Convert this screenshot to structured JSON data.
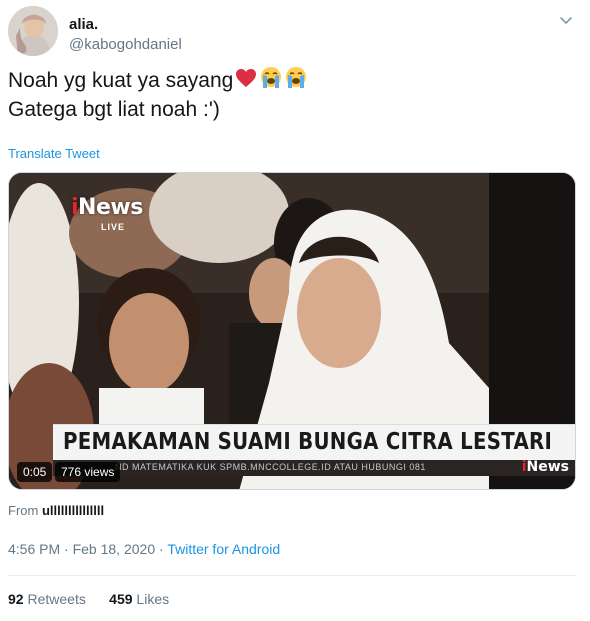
{
  "user": {
    "display_name": "alia.",
    "handle": "@kabogohdaniel"
  },
  "tweet": {
    "line1": "Noah yg kuat ya sayang",
    "line1_emojis": [
      "red-heart-icon",
      "loudly-crying-face-icon",
      "loudly-crying-face-icon"
    ],
    "line2": "Gatega bgt liat noah :')",
    "translate_label": "Translate Tweet"
  },
  "media": {
    "channel_logo_pre": "i",
    "channel_logo_rest": "News",
    "channel_live": "LIVE",
    "headline": "PEMAKAMAN SUAMI BUNGA CITRA LESTARI",
    "ticker": "ND MATEMATIKA KUK SPMB.MNCCOLLEGE.ID ATAU HUBUNGI 081",
    "duration": "0:05",
    "views": "776 views"
  },
  "source": {
    "prefix": "From",
    "name": "ulllllllllllllll"
  },
  "meta": {
    "time": "4:56 PM",
    "sep1": " · ",
    "date": "Feb 18, 2020",
    "sep2": " · ",
    "client": "Twitter for Android"
  },
  "stats": {
    "retweets_count": "92",
    "retweets_label": "Retweets",
    "likes_count": "459",
    "likes_label": "Likes"
  },
  "colors": {
    "link": "#1b95e0",
    "secondary_text": "#657786",
    "primary_text": "#14171a",
    "divider": "#e6ecf0"
  }
}
